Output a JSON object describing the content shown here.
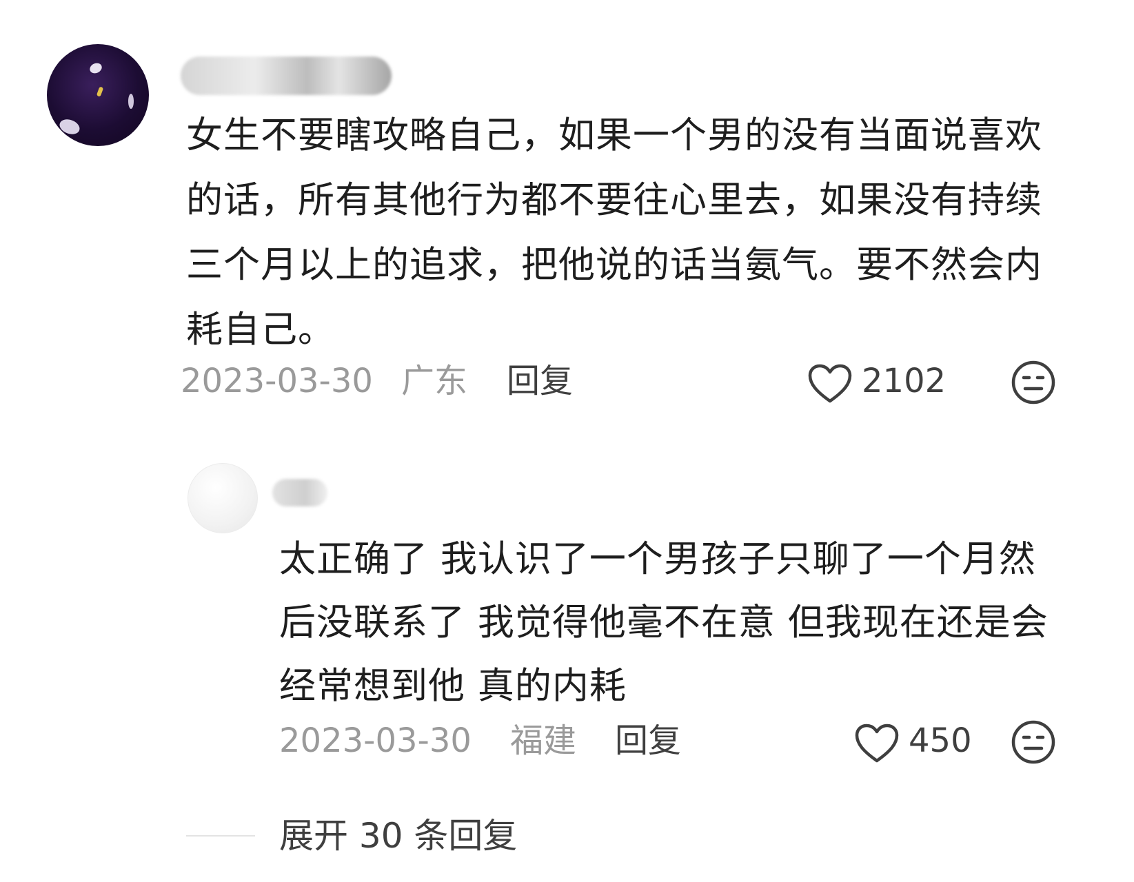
{
  "main_comment": {
    "username": "",
    "text": "女生不要瞎攻略自己，如果一个男的没有当面说喜欢的话，所有其他行为都不要往心里去，如果没有持续三个月以上的追求，把他说的话当氨气。要不然会内耗自己。",
    "date": "2023-03-30",
    "location": "广东",
    "reply_label": "回复",
    "like_count": "2102",
    "icons": [
      "avatar",
      "heart-icon",
      "dislike-face-icon"
    ]
  },
  "reply": {
    "username": "",
    "text": "太正确了 我认识了一个男孩子只聊了一个月然后没联系了 我觉得他毫不在意 但我现在还是会经常想到他 真的内耗",
    "date": "2023-03-30",
    "location": "福建",
    "reply_label": "回复",
    "like_count": "450",
    "icons": [
      "avatar",
      "heart-icon",
      "dislike-face-icon"
    ]
  },
  "expand": {
    "label": "展开 30 条回复"
  },
  "colors": {
    "text": "#1e1e1e",
    "meta_gray": "#9a9a9a",
    "reply_dark": "#3f3f3f",
    "background": "#ffffff"
  }
}
